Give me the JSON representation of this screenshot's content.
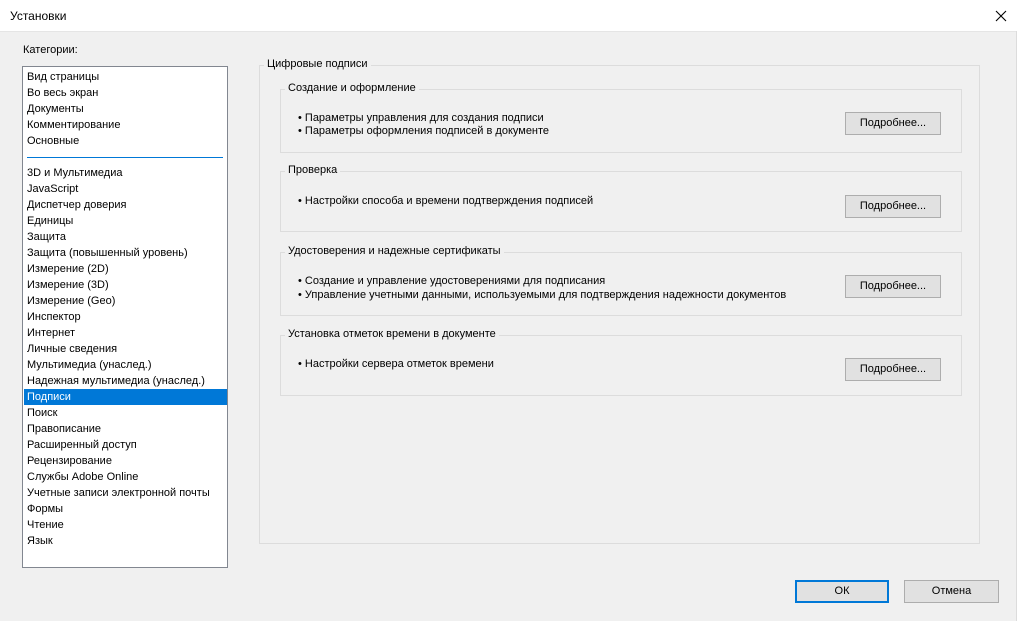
{
  "window": {
    "title": "Установки",
    "close_icon": "close-icon"
  },
  "categories": {
    "label": "Категории:",
    "top_items": [
      "Вид страницы",
      "Во весь экран",
      "Документы",
      "Комментирование",
      "Основные"
    ],
    "items": [
      "3D и Мультимедиа",
      "JavaScript",
      "Диспетчер доверия",
      "Единицы",
      "Защита",
      "Защита (повышенный уровень)",
      "Измерение (2D)",
      "Измерение (3D)",
      "Измерение (Geo)",
      "Инспектор",
      "Интернет",
      "Личные сведения",
      "Мультимедиа (унаслед.)",
      "Надежная мультимедиа (унаслед.)",
      "Подписи",
      "Поиск",
      "Правописание",
      "Расширенный доступ",
      "Рецензирование",
      "Службы Adobe Online",
      "Учетные записи электронной почты",
      "Формы",
      "Чтение",
      "Язык"
    ],
    "selected": "Подписи"
  },
  "main": {
    "title": "Цифровые подписи",
    "sections": [
      {
        "title": "Создание и оформление",
        "bullets": [
          "• Параметры управления для создания подписи",
          "• Параметры оформления подписей в документе"
        ],
        "button": "Подробнее..."
      },
      {
        "title": "Проверка",
        "bullets": [
          "• Настройки способа и времени подтверждения подписей"
        ],
        "button": "Подробнее..."
      },
      {
        "title": "Удостоверения и надежные сертификаты",
        "bullets": [
          "• Создание и управление удостоверениями для подписания",
          "• Управление учетными данными, используемыми для подтверждения надежности документов"
        ],
        "button": "Подробнее..."
      },
      {
        "title": "Установка отметок времени в документе",
        "bullets": [
          "• Настройки сервера отметок времени"
        ],
        "button": "Подробнее..."
      }
    ]
  },
  "footer": {
    "ok": "ОК",
    "cancel": "Отмена"
  },
  "colors": {
    "selection": "#0078d7",
    "background": "#f0f0f0",
    "border": "#dcdcdc"
  }
}
